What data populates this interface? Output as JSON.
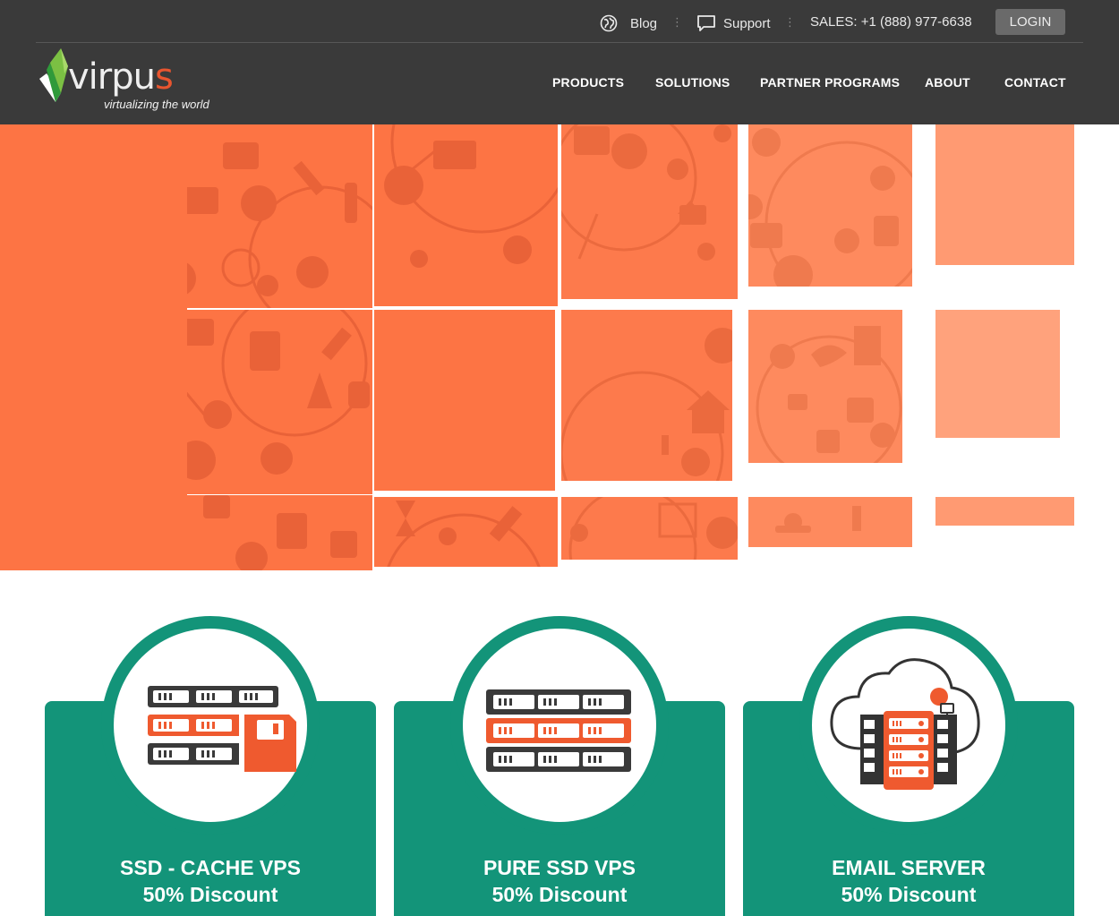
{
  "topbar": {
    "blog_label": "Blog",
    "support_label": "Support",
    "sales_label": "SALES: +1 (888) 977-6638",
    "login_label": "LOGIN",
    "separator": "⋮"
  },
  "logo": {
    "word_main": "virpu",
    "word_accent": "s",
    "tagline": "virtualizing the world"
  },
  "nav": {
    "items": [
      "PRODUCTS",
      "SOLUTIONS",
      "PARTNER PROGRAMS",
      "ABOUT",
      "CONTACT"
    ]
  },
  "colors": {
    "header_bg": "#3a3a3a",
    "accent_orange": "#fd7444",
    "card_teal": "#139479"
  },
  "icons": {
    "blog": "globe-icon",
    "support": "chat-bubble-icon",
    "card1": "server-floppy-icon",
    "card2": "server-rack-icon",
    "card3": "cloud-server-icon"
  },
  "cards": [
    {
      "title": "SSD - CACHE VPS",
      "subtitle": "50% Discount"
    },
    {
      "title": "PURE SSD VPS",
      "subtitle": "50% Discount"
    },
    {
      "title": "EMAIL SERVER",
      "subtitle": "50% Discount"
    }
  ]
}
